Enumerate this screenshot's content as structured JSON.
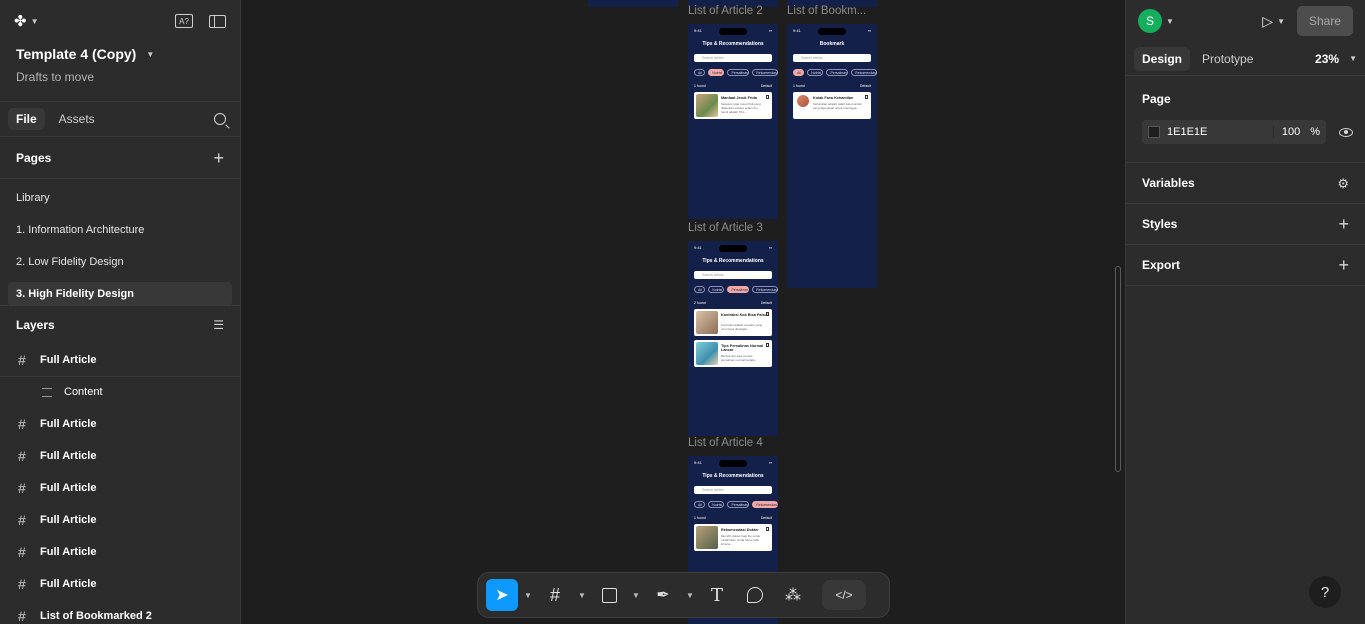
{
  "file": {
    "name": "Template 4 (Copy)",
    "location": "Drafts to move"
  },
  "left_tabs": [
    "File",
    "Assets"
  ],
  "pages": {
    "heading": "Pages",
    "items": [
      "Library",
      "1. Information Architecture",
      "2. Low Fidelity Design",
      "3. High Fidelity Design"
    ]
  },
  "layers": {
    "heading": "Layers",
    "items": [
      {
        "label": "Full Article",
        "type": "frame"
      },
      {
        "label": "Content",
        "type": "text"
      },
      {
        "label": "Full Article",
        "type": "frame"
      },
      {
        "label": "Full Article",
        "type": "frame"
      },
      {
        "label": "Full Article",
        "type": "frame"
      },
      {
        "label": "Full Article",
        "type": "frame"
      },
      {
        "label": "Full Article",
        "type": "frame"
      },
      {
        "label": "Full Article",
        "type": "frame"
      },
      {
        "label": "List of Bookmarked 2",
        "type": "frame"
      }
    ]
  },
  "canvas": {
    "frames": [
      {
        "label": "List of Article 2",
        "title": "Tips & Recommendations",
        "count": "1 found",
        "sort": "Default",
        "search": "Search article...",
        "chips": [
          "All",
          "Nutrisi",
          "Persalinan",
          "Rekomendasi"
        ],
        "active_chip": 1,
        "cards": [
          {
            "title": "Manfaat Jeruk Frida",
            "desc": "Sebelum pijat rosan Kidl yang dilakukan terbaru selain ibu hamil adalah KKL..."
          }
        ]
      },
      {
        "label": "List of Bookm...",
        "title": "Bookmark",
        "count": "1 found",
        "sort": "Default",
        "search": "Search article...",
        "chips": [
          "All",
          "Nutrisi",
          "Persalinan",
          "Rekomendasi"
        ],
        "active_chip": 0,
        "cards": [
          {
            "title": "Kolak Fava Kehamilan",
            "desc": "Kehamilan adalah salah satu kondisi yang digunakan untuk meningga..."
          }
        ]
      },
      {
        "label": "List of Article 3",
        "title": "Tips & Recommendations",
        "count": "2 found",
        "sort": "Default",
        "search": "Search article...",
        "chips": [
          "All",
          "Nutrisi",
          "Persalinan",
          "Rekomendasi"
        ],
        "active_chip": 2,
        "cards": [
          {
            "title": "Kontraksi Kok Bisa Palsu?",
            "desc": "Kontraksi adalah sesuatu yang umumnya dipelajari..."
          },
          {
            "title": "Tips Persalinan Normal Lancar",
            "desc": "Berikut tips agar proses persalinan normal berjala..."
          }
        ]
      },
      {
        "label": "List of Article 4",
        "title": "Tips & Recommendations",
        "count": "1 found",
        "sort": "Default",
        "search": "Search article...",
        "chips": [
          "All",
          "Nutrisi",
          "Persalinan",
          "Rekomendasi"
        ],
        "active_chip": 3,
        "cards": [
          {
            "title": "Rekomendasi Dokter",
            "desc": "Memilih dokter bagi ibu untuk melahirkan. Anda harus tahu kriteria..."
          }
        ]
      }
    ],
    "status_time": "9:41"
  },
  "toolbar": {
    "tools": [
      "move-tool",
      "frame-tool",
      "shape-tool",
      "pen-tool",
      "text-tool",
      "comment-tool",
      "actions-tool"
    ],
    "dev_mode": "</>"
  },
  "right": {
    "avatar_initial": "S",
    "share_label": "Share",
    "tabs": [
      "Design",
      "Prototype"
    ],
    "zoom": "23%",
    "page_heading": "Page",
    "page_color": "1E1E1E",
    "page_opacity": "100",
    "page_opacity_unit": "%",
    "sections": [
      "Variables",
      "Styles",
      "Export"
    ],
    "help": "?"
  },
  "colors": {
    "accent": "#0d99ff",
    "frame_bg": "#13204a",
    "canvas_bg": "#1e1e1e",
    "panel_bg": "#2c2c2c",
    "avatar": "#14ae5c",
    "chip_active": "#f2a8a8"
  }
}
